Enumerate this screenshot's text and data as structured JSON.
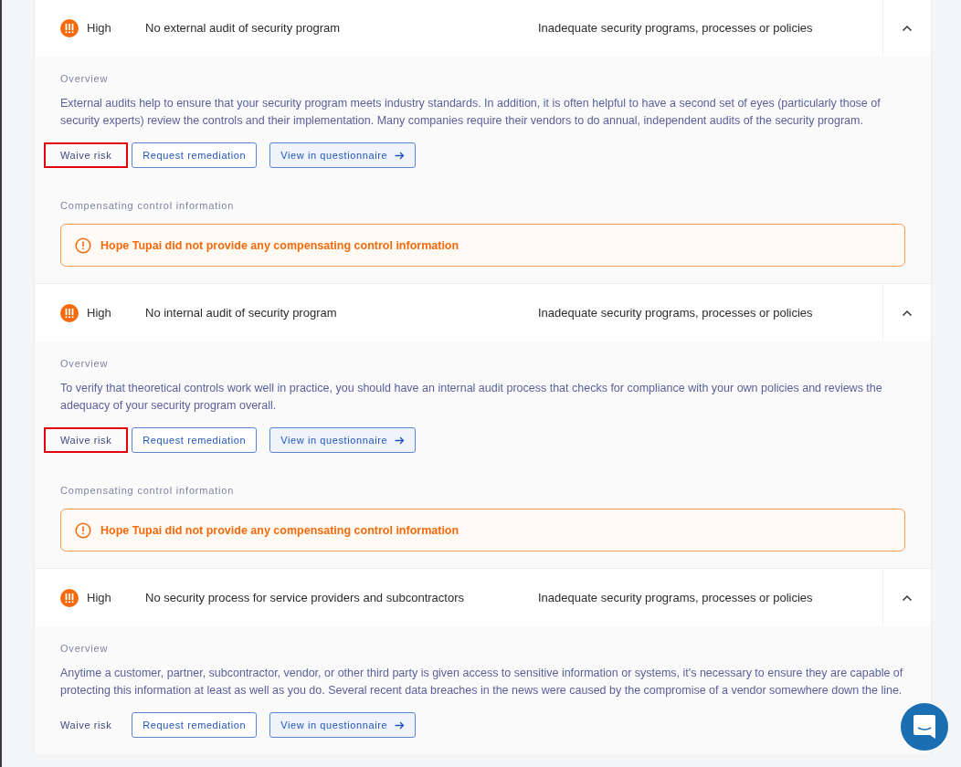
{
  "findings": [
    {
      "severity": "High",
      "title": "No external audit of security program",
      "category": "Inadequate security programs, processes or policies",
      "expanded": true,
      "overview_label": "Overview",
      "overview": "External audits help to ensure that your security program meets industry standards. In addition, it is often helpful to have a second set of eyes (particularly those of security experts) review the controls and their implementation. Many companies require their vendors to do annual, independent audits of the security program.",
      "actions": [
        {
          "kind": "waive",
          "label": "Waive risk",
          "highlighted": true
        },
        {
          "kind": "remediation",
          "label": "Request remediation",
          "highlighted": false
        },
        {
          "kind": "questionnaire",
          "label": "View in questionnaire",
          "highlighted": false
        }
      ],
      "compensating_label": "Compensating control information",
      "compensating_message": "Hope Tupai did not provide any compensating control information"
    },
    {
      "severity": "High",
      "title": "No internal audit of security program",
      "category": "Inadequate security programs, processes or policies",
      "expanded": true,
      "overview_label": "Overview",
      "overview": "To verify that theoretical controls work well in practice, you should have an internal audit process that checks for compliance with your own policies and reviews the adequacy of your security program overall.",
      "actions": [
        {
          "kind": "waive",
          "label": "Waive risk",
          "highlighted": true
        },
        {
          "kind": "remediation",
          "label": "Request remediation",
          "highlighted": false
        },
        {
          "kind": "questionnaire",
          "label": "View in questionnaire",
          "highlighted": false
        }
      ],
      "compensating_label": "Compensating control information",
      "compensating_message": "Hope Tupai did not provide any compensating control information"
    },
    {
      "severity": "High",
      "title": "No security process for service providers and subcontractors",
      "category": "Inadequate security programs, processes or policies",
      "expanded": true,
      "overview_label": "Overview",
      "overview": "Anytime a customer, partner, subcontractor, vendor, or other third party is given access to sensitive information or systems, it's necessary to ensure they are capable of protecting this information at least as well as you do. Several recent data breaches in the news were caused by the compromise of a vendor somewhere down the line.",
      "actions": [
        {
          "kind": "waive",
          "label": "Waive risk",
          "highlighted": false
        },
        {
          "kind": "remediation",
          "label": "Request remediation",
          "highlighted": false
        },
        {
          "kind": "questionnaire",
          "label": "View in questionnaire",
          "highlighted": false
        }
      ]
    }
  ]
}
